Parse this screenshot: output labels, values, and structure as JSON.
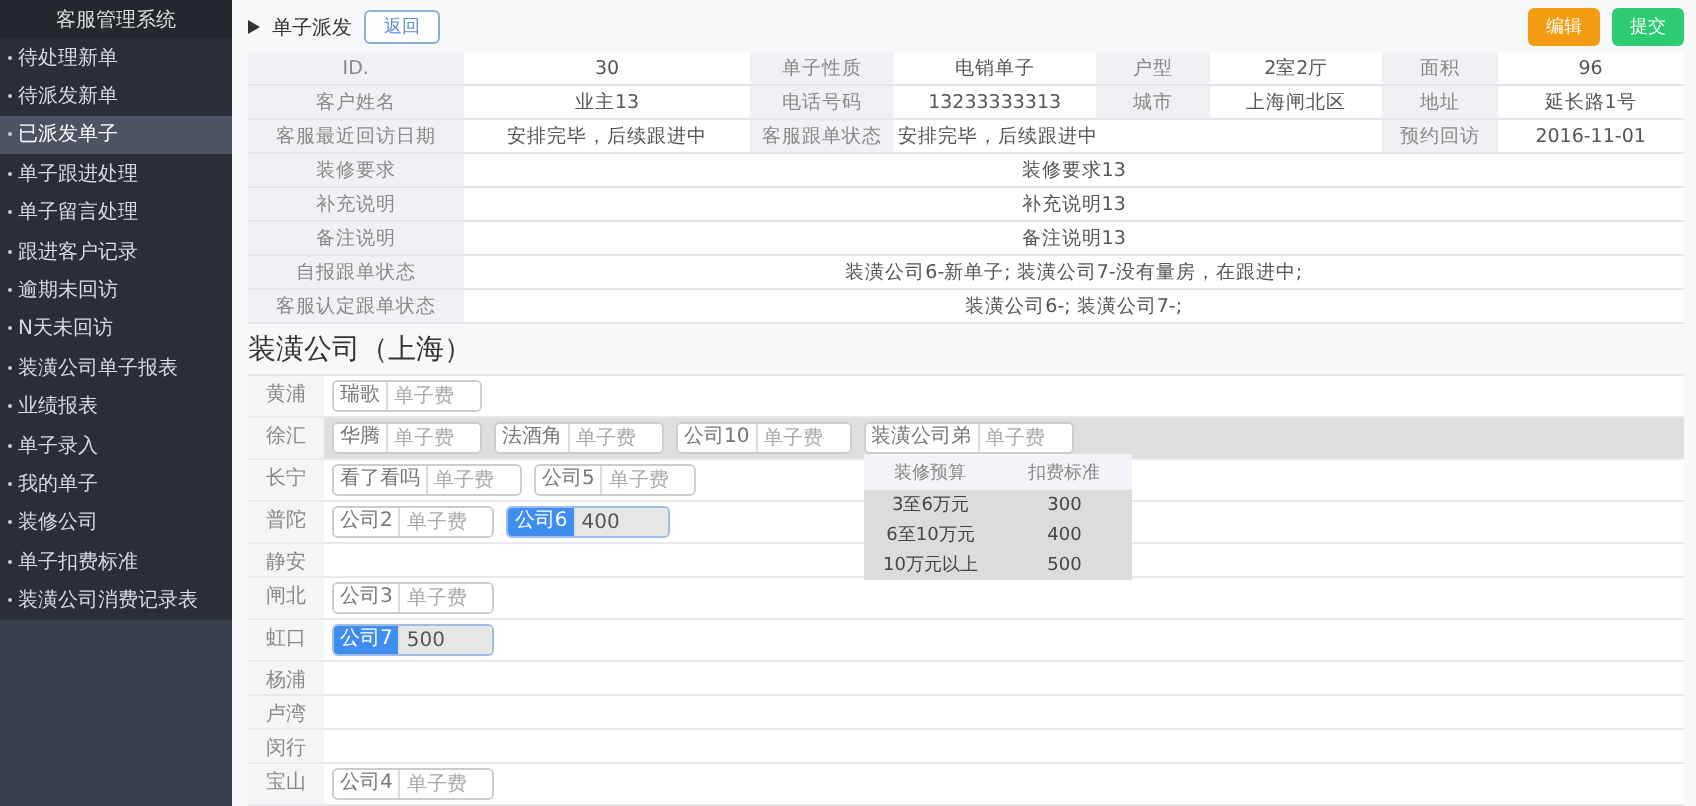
{
  "sidebar": {
    "title": "客服管理系统",
    "items": [
      {
        "label": "待处理新单",
        "selected": false
      },
      {
        "label": "待派发新单",
        "selected": false
      },
      {
        "label": "已派发单子",
        "selected": true
      },
      {
        "label": "单子跟进处理",
        "selected": false
      },
      {
        "label": "单子留言处理",
        "selected": false
      },
      {
        "label": "跟进客户记录",
        "selected": false
      },
      {
        "label": "逾期未回访",
        "selected": false
      },
      {
        "label": "N天未回访",
        "selected": false
      },
      {
        "label": "装潢公司单子报表",
        "selected": false
      },
      {
        "label": "业绩报表",
        "selected": false
      },
      {
        "label": "单子录入",
        "selected": false
      },
      {
        "label": "我的单子",
        "selected": false
      },
      {
        "label": "装修公司",
        "selected": false
      },
      {
        "label": "单子扣费标准",
        "selected": false
      },
      {
        "label": "装潢公司消费记录表",
        "selected": false
      }
    ]
  },
  "header": {
    "title": "单子派发",
    "back_button": "返回",
    "buttons": [
      {
        "label": "编辑",
        "kind": "warning"
      },
      {
        "label": "提交",
        "kind": "success"
      }
    ]
  },
  "info_table": {
    "rows": [
      [
        {
          "text": "ID.",
          "kind": "label"
        },
        {
          "text": "30",
          "kind": "value"
        },
        {
          "text": "单子性质",
          "kind": "label"
        },
        {
          "text": "电销单子",
          "kind": "value"
        },
        {
          "text": "户型",
          "kind": "label"
        },
        {
          "text": "2室2厅",
          "kind": "value"
        },
        {
          "text": "面积",
          "kind": "label"
        },
        {
          "text": "96",
          "kind": "value"
        }
      ],
      [
        {
          "text": "客户姓名",
          "kind": "label"
        },
        {
          "text": "业主13",
          "kind": "value"
        },
        {
          "text": "电话号码",
          "kind": "label"
        },
        {
          "text": "13233333313",
          "kind": "value"
        },
        {
          "text": "城市",
          "kind": "label"
        },
        {
          "text": "上海闸北区",
          "kind": "value"
        },
        {
          "text": "地址",
          "kind": "label"
        },
        {
          "text": "延长路1号",
          "kind": "value"
        }
      ],
      [
        {
          "text": "客服最近回访日期",
          "kind": "label"
        },
        {
          "text": "安排完毕，后续跟进中",
          "kind": "value"
        },
        {
          "text": "客服跟单状态",
          "kind": "label"
        },
        {
          "text": "安排完毕，后续跟进中",
          "kind": "value"
        },
        {
          "text": "",
          "kind": "value"
        },
        {
          "text": "",
          "kind": "value"
        },
        {
          "text": "预约回访",
          "kind": "label"
        },
        {
          "text": "2016-11-01",
          "kind": "value"
        }
      ]
    ]
  },
  "notes_table": {
    "rows": [
      [
        {
          "text": "装修要求",
          "kind": "label"
        },
        {
          "text": "装修要求13",
          "kind": "value"
        }
      ],
      [
        {
          "text": "补充说明",
          "kind": "label"
        },
        {
          "text": "补充说明13",
          "kind": "value"
        }
      ],
      [
        {
          "text": "备注说明",
          "kind": "label"
        },
        {
          "text": "备注说明13",
          "kind": "value"
        }
      ],
      [
        {
          "text": "自报跟单状态",
          "kind": "label"
        },
        {
          "text": "装潢公司6-新单子; 装潢公司7-没有量房，在跟进中;",
          "kind": "value"
        }
      ],
      [
        {
          "text": "客服认定跟单状态",
          "kind": "label"
        },
        {
          "text": "装潢公司6-; 装潢公司7-;",
          "kind": "value"
        }
      ]
    ]
  },
  "companies": {
    "heading": "装潢公司（上海）",
    "districts": [
      {
        "name": "黄浦",
        "highlighted": false,
        "companies": [
          {
            "name": "瑞歌",
            "selected": false,
            "placeholder": "单子费"
          }
        ]
      },
      {
        "name": "徐汇",
        "highlighted": true,
        "companies": [
          {
            "name": "华腾",
            "selected": false,
            "placeholder": "单子费"
          },
          {
            "name": "法酒角",
            "selected": false,
            "placeholder": "单子费"
          },
          {
            "name": "公司10",
            "selected": false,
            "placeholder": "单子费"
          },
          {
            "name": "装潢公司弟",
            "selected": false,
            "placeholder": "单子费",
            "popover": {
              "columns": [
                "装修预算",
                "扣费标准"
              ],
              "rows": [
                [
                  "3至6万元",
                  "300"
                ],
                [
                  "6至10万元",
                  "400"
                ],
                [
                  "10万元以上",
                  "500"
                ]
              ]
            }
          }
        ]
      },
      {
        "name": "长宁",
        "highlighted": false,
        "companies": [
          {
            "name": "看了看吗",
            "selected": false,
            "placeholder": "单子费"
          },
          {
            "name": "公司5",
            "selected": false,
            "placeholder": "单子费"
          }
        ]
      },
      {
        "name": "普陀",
        "highlighted": false,
        "companies": [
          {
            "name": "公司2",
            "selected": false,
            "placeholder": "单子费"
          },
          {
            "name": "公司6",
            "selected": true,
            "value": "400"
          }
        ]
      },
      {
        "name": "静安",
        "highlighted": false
      },
      {
        "name": "闸北",
        "highlighted": false,
        "companies": [
          {
            "name": "公司3",
            "selected": false,
            "placeholder": "单子费"
          }
        ]
      },
      {
        "name": "虹口",
        "highlighted": false,
        "companies": [
          {
            "name": "公司7",
            "selected": true,
            "value": "500"
          }
        ]
      },
      {
        "name": "杨浦",
        "highlighted": false
      },
      {
        "name": "卢湾",
        "highlighted": false
      },
      {
        "name": "闵行",
        "highlighted": false
      },
      {
        "name": "宝山",
        "highlighted": false,
        "companies": [
          {
            "name": "公司4",
            "selected": false,
            "placeholder": "单子费"
          }
        ]
      }
    ]
  }
}
